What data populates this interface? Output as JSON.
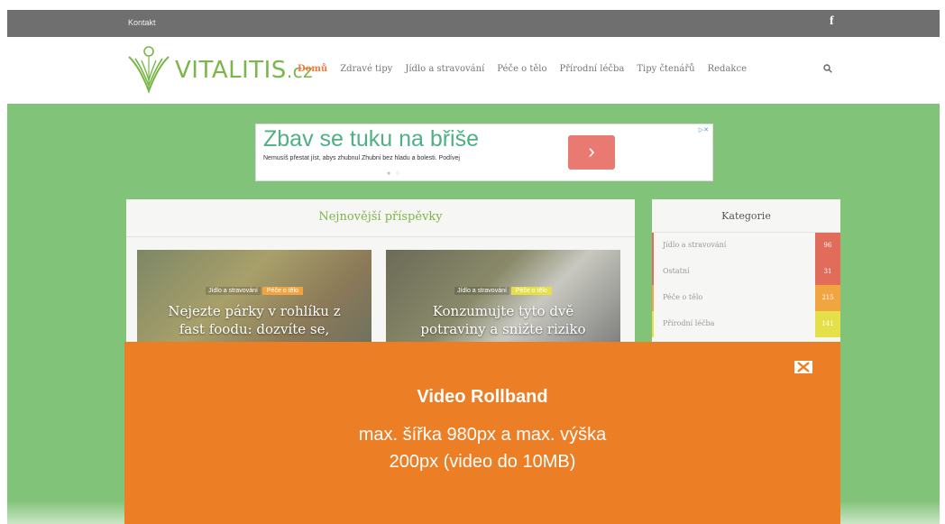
{
  "topbar": {
    "link": "Kontakt",
    "facebook": "f"
  },
  "header": {
    "logo_main": "VITALITIS",
    "logo_tld": ".cz",
    "nav": [
      {
        "label": "Domů",
        "active": true
      },
      {
        "label": "Zdravé tipy"
      },
      {
        "label": "Jídlo a stravování"
      },
      {
        "label": "Péče o tělo"
      },
      {
        "label": "Přírodní léčba"
      },
      {
        "label": "Tipy čtenářů"
      },
      {
        "label": "Redakce"
      }
    ],
    "search_icon": "search-icon"
  },
  "ad": {
    "title": "Zbav se tuku na břiše",
    "description": "Nemusíš přestat jíst, abys zhubnul Zhubni bez hladu a bolesti. Podívej",
    "arrow": "›",
    "dots": "● ○"
  },
  "main": {
    "heading": "Nejnovější příspěvky",
    "cards": [
      {
        "tag1": "Jídlo a stravování",
        "tag2": "Péče o tělo",
        "title_line1": "Nejezte párky v rohlíku z",
        "title_line2": "fast foodu: dozvíte se,"
      },
      {
        "tag1": "Jídlo a stravování",
        "tag2": "Péče o tělo",
        "title_line1": "Konzumujte tyto dvě",
        "title_line2": "potraviny a snižte riziko"
      }
    ]
  },
  "sidebar": {
    "heading": "Kategorie",
    "items": [
      {
        "label": "Jídlo a stravování",
        "count": "96",
        "color": "#e26c5a"
      },
      {
        "label": "Ostatní",
        "count": "31",
        "color": "#e26c5a"
      },
      {
        "label": "Péče o tělo",
        "count": "215",
        "color": "#f1a541"
      },
      {
        "label": "Přírodní léčba",
        "count": "141",
        "color": "#e5e04a"
      }
    ]
  },
  "overlay": {
    "title": "Video Rollband",
    "line1": "max. šířka 980px a max. výška",
    "line2": "200px (video do 10MB)"
  },
  "colors": {
    "green_bg": "#82c37a",
    "brand_green": "#7ab648",
    "overlay_orange": "#ec7e26",
    "topbar": "#6f6f6f"
  }
}
